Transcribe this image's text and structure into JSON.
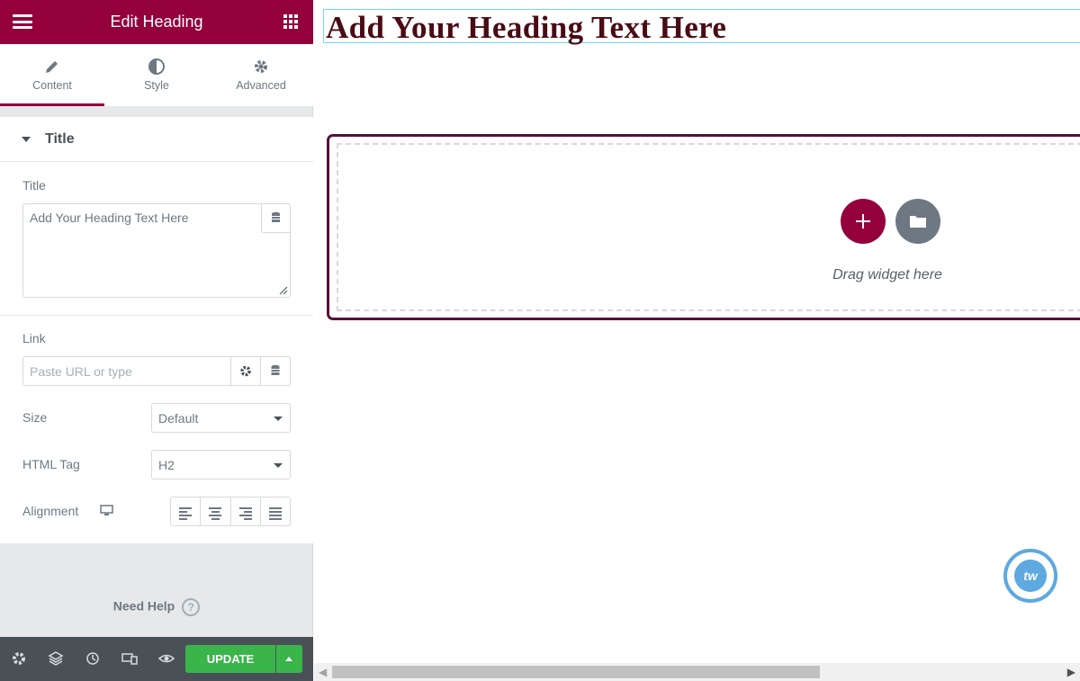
{
  "panel": {
    "title": "Edit Heading",
    "tabs": [
      {
        "label": "Content",
        "icon": "pencil-icon",
        "active": true
      },
      {
        "label": "Style",
        "icon": "contrast-icon",
        "active": false
      },
      {
        "label": "Advanced",
        "icon": "gear-icon",
        "active": false
      }
    ],
    "section": {
      "title": "Title"
    },
    "title_field": {
      "label": "Title",
      "value": "Add Your Heading Text Here"
    },
    "link_field": {
      "label": "Link",
      "placeholder": "Paste URL or type"
    },
    "size_field": {
      "label": "Size",
      "value": "Default"
    },
    "html_tag_field": {
      "label": "HTML Tag",
      "value": "H2"
    },
    "alignment_field": {
      "label": "Alignment"
    },
    "help": {
      "label": "Need Help"
    },
    "footer": {
      "update_label": "UPDATE"
    }
  },
  "canvas": {
    "heading_text": "Add Your Heading Text Here",
    "drag_text": "Drag widget here",
    "badge_text": "tw"
  },
  "colors": {
    "brand": "#93003c",
    "update_green": "#39b54a",
    "heading_color": "#4a0c14"
  }
}
